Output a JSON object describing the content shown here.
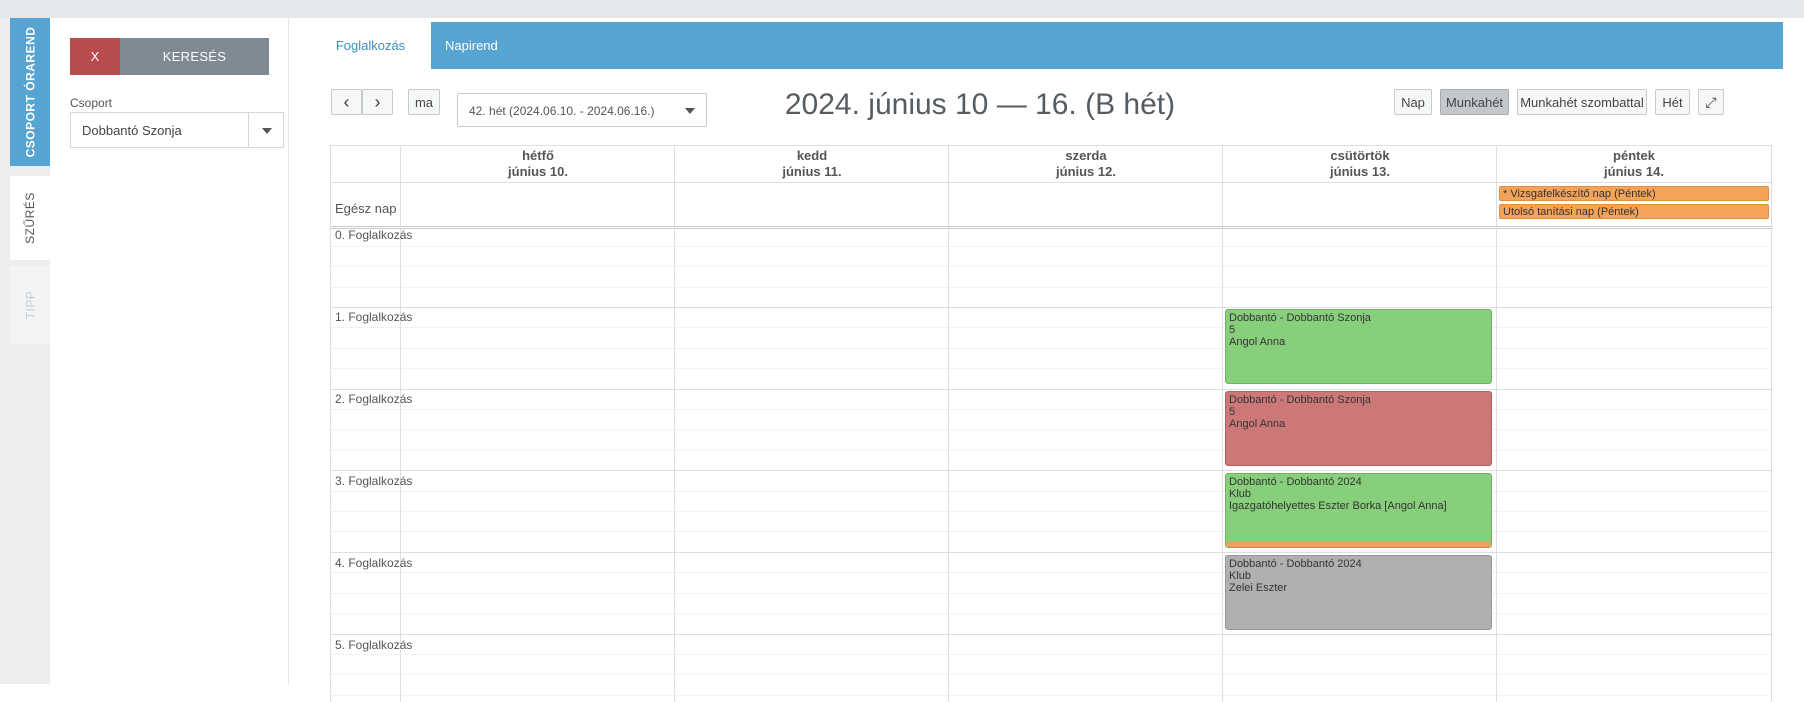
{
  "sidebar_tabs": [
    {
      "label": "CSOPORT ÓRAREND"
    },
    {
      "label": "SZŰRÉS"
    },
    {
      "label": "TIPP"
    }
  ],
  "filter": {
    "clear_label": "X",
    "search_label": "KERESÉS",
    "group_label": "Csoport",
    "group_value": "Dobbantó Szonja"
  },
  "tabs": {
    "active": "Foglalkozás",
    "other": "Napirend"
  },
  "toolbar": {
    "prev": "‹",
    "next": "›",
    "today": "ma",
    "week_select": "42. hét (2024.06.10. - 2024.06.16.)",
    "title": "2024. június 10 — 16. (B hét)",
    "views": [
      "Nap",
      "Munkahét",
      "Munkahét szombattal",
      "Hét"
    ],
    "active_view": "Munkahét",
    "fullscreen": "⤢"
  },
  "calendar": {
    "days": [
      {
        "name": "hétfő",
        "date": "június 10."
      },
      {
        "name": "kedd",
        "date": "június 11."
      },
      {
        "name": "szerda",
        "date": "június 12."
      },
      {
        "name": "csütörtök",
        "date": "június 13."
      },
      {
        "name": "péntek",
        "date": "június 14."
      }
    ],
    "allday_label": "Egész nap",
    "allday_events": [
      {
        "text": "* Vizsgafelkészítő nap (Péntek)",
        "color": "#f3a45a"
      },
      {
        "text": "Utolsó tanítási nap (Péntek)",
        "color": "#f3a45a"
      }
    ],
    "periods": [
      "0. Foglalkozás",
      "1. Foglalkozás",
      "2. Foglalkozás",
      "3. Foglalkozás",
      "4. Foglalkozás",
      "5. Foglalkozás"
    ],
    "events": [
      {
        "line1": "Dobbantó - Dobbantó Szonja",
        "line2": "5",
        "line3": "Angol Anna",
        "color": "#88cf7c"
      },
      {
        "line1": "Dobbantó - Dobbantó Szonja",
        "line2": "5",
        "line3": "Angol Anna",
        "color": "#cd7878"
      },
      {
        "line1": "Dobbantó - Dobbantó 2024",
        "line2": "Klub",
        "line3": "Igazgatóhelyettes Eszter Borka [Angol Anna]",
        "color": "#88cf7c"
      },
      {
        "line1": "Dobbantó - Dobbantó 2024",
        "line2": "Klub",
        "line3": "Zelei Eszter",
        "color": "#b0b0b0"
      }
    ]
  }
}
